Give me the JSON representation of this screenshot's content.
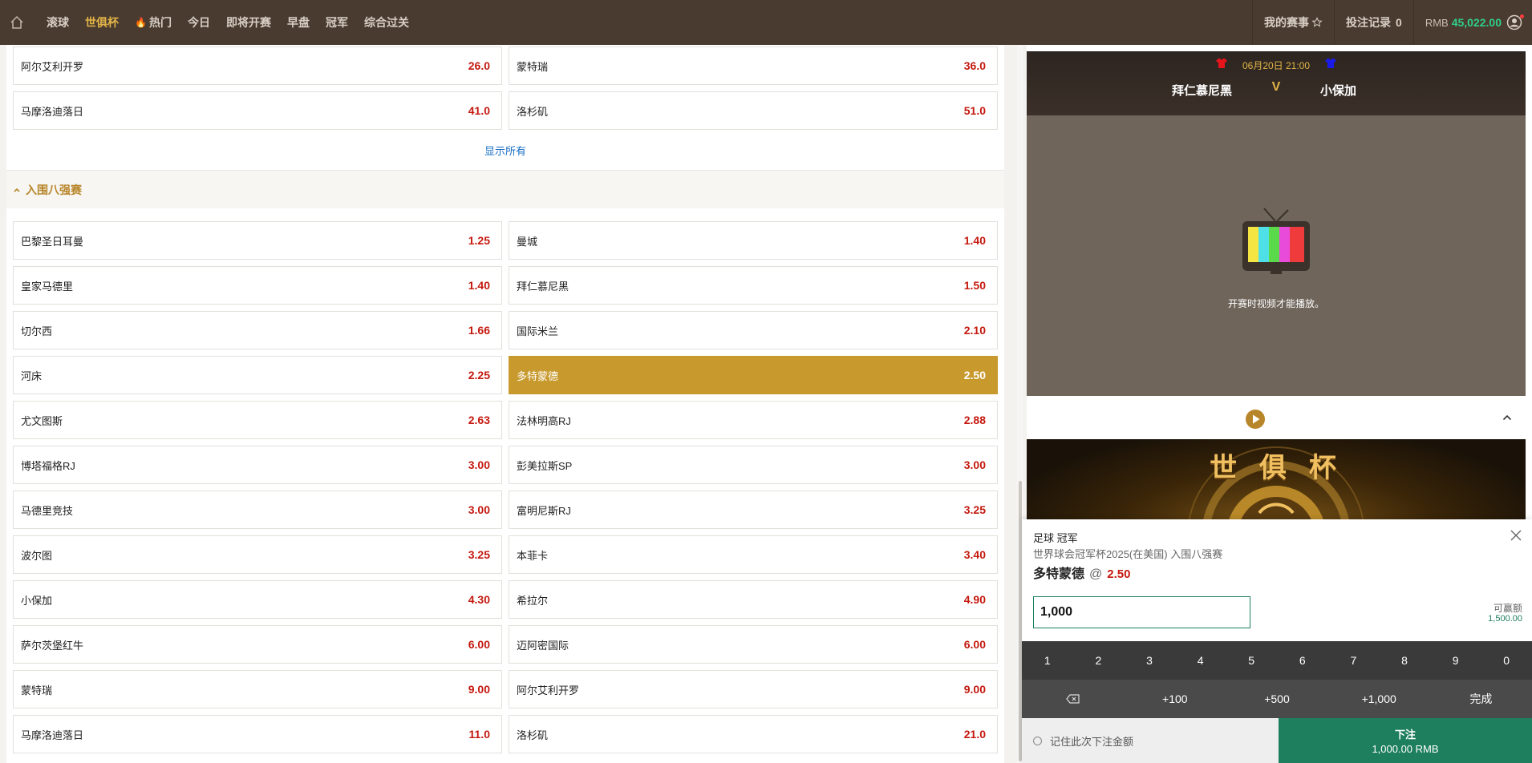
{
  "nav": {
    "items": [
      "滚球",
      "世俱杯",
      "热门",
      "今日",
      "即将开赛",
      "早盘",
      "冠军",
      "综合过关"
    ],
    "active_index": 1,
    "hot_index": 2
  },
  "header": {
    "my_matches": "我的赛事",
    "bet_records": "投注记录",
    "bet_records_count": "0",
    "currency": "RMB",
    "balance": "45,022.00"
  },
  "top_rows": [
    {
      "left": {
        "team": "阿尔艾利开罗",
        "odds": "26.0"
      },
      "right": {
        "team": "蒙特瑞",
        "odds": "36.0"
      }
    },
    {
      "left": {
        "team": "马摩洛迪落日",
        "odds": "41.0"
      },
      "right": {
        "team": "洛杉矶",
        "odds": "51.0"
      }
    }
  ],
  "show_all": "显示所有",
  "section": {
    "title": "入围八强赛",
    "rows": [
      {
        "left": {
          "team": "巴黎圣日耳曼",
          "odds": "1.25"
        },
        "right": {
          "team": "曼城",
          "odds": "1.40"
        }
      },
      {
        "left": {
          "team": "皇家马德里",
          "odds": "1.40"
        },
        "right": {
          "team": "拜仁慕尼黑",
          "odds": "1.50"
        }
      },
      {
        "left": {
          "team": "切尔西",
          "odds": "1.66"
        },
        "right": {
          "team": "国际米兰",
          "odds": "2.10"
        }
      },
      {
        "left": {
          "team": "河床",
          "odds": "2.25"
        },
        "right": {
          "team": "多特蒙德",
          "odds": "2.50",
          "selected": true
        }
      },
      {
        "left": {
          "team": "尤文图斯",
          "odds": "2.63"
        },
        "right": {
          "team": "法林明高RJ",
          "odds": "2.88"
        }
      },
      {
        "left": {
          "team": "博塔福格RJ",
          "odds": "3.00"
        },
        "right": {
          "team": "彭美拉斯SP",
          "odds": "3.00"
        }
      },
      {
        "left": {
          "team": "马德里竞技",
          "odds": "3.00"
        },
        "right": {
          "team": "富明尼斯RJ",
          "odds": "3.25"
        }
      },
      {
        "left": {
          "team": "波尔图",
          "odds": "3.25"
        },
        "right": {
          "team": "本菲卡",
          "odds": "3.40"
        }
      },
      {
        "left": {
          "team": "小保加",
          "odds": "4.30"
        },
        "right": {
          "team": "希拉尔",
          "odds": "4.90"
        }
      },
      {
        "left": {
          "team": "萨尔茨堡红牛",
          "odds": "6.00"
        },
        "right": {
          "team": "迈阿密国际",
          "odds": "6.00"
        }
      },
      {
        "left": {
          "team": "蒙特瑞",
          "odds": "9.00"
        },
        "right": {
          "team": "阿尔艾利开罗",
          "odds": "9.00"
        }
      },
      {
        "left": {
          "team": "马摩洛迪落日",
          "odds": "11.0"
        },
        "right": {
          "team": "洛杉矶",
          "odds": "21.0"
        }
      }
    ]
  },
  "match": {
    "time": "06月20日 21:00",
    "home": "拜仁慕尼黑",
    "vs": "V",
    "away": "小保加",
    "home_kit_color": "#e8141b",
    "away_kit_color": "#1b1be8",
    "video_msg": "开赛时视频才能播放。"
  },
  "banner": {
    "title": "世 俱 杯"
  },
  "betslip": {
    "sport": "足球 冠军",
    "league": "世界球会冠军杯2025(在美国) 入围八强赛",
    "pick": "多特蒙德",
    "at": "@",
    "odds": "2.50",
    "stake": "1,000",
    "max_label": "可赢额",
    "max_value": "1,500.00",
    "digits": [
      "1",
      "2",
      "3",
      "4",
      "5",
      "6",
      "7",
      "8",
      "9",
      "0"
    ],
    "quick": [
      "+100",
      "+500",
      "+1,000"
    ],
    "done": "完成",
    "remember": "记住此次下注金额",
    "place_label": "下注",
    "place_amount": "1,000.00 RMB"
  },
  "colors": {
    "topbar": "#4a3b30",
    "accent_gold": "#c89a2e",
    "odds_red": "#c4180e",
    "green": "#1e7f5e",
    "balance_green": "#2fcf8a"
  }
}
